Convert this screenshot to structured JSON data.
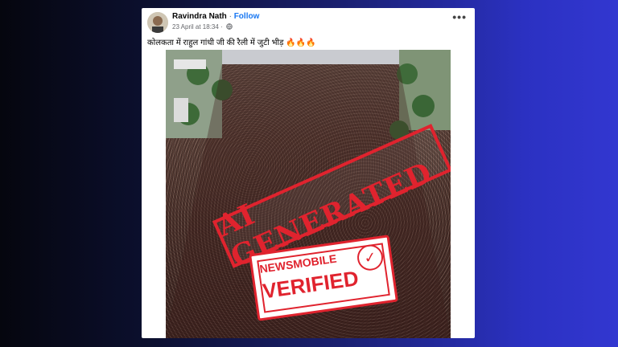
{
  "post": {
    "author": "Ravindra Nath",
    "separator": "·",
    "follow_label": "Follow",
    "timestamp": "23 April at 18:34",
    "timestamp_separator": "·",
    "more_label": "•••",
    "caption": "कोलकता में राहुल गांधी जी की रैली में जुटी भीड़ 🔥🔥🔥"
  },
  "photo": {
    "stamp_ai_text": "AI GENERATED",
    "stamp_verified_line1": "NEWSMOBILE",
    "stamp_verified_line2": "VERIFIED",
    "stamp_check": "✓",
    "stamp_color": "#e0232e"
  },
  "colors": {
    "follow": "#1877f2",
    "background_left": "#05060e",
    "background_right": "#3237d0"
  }
}
